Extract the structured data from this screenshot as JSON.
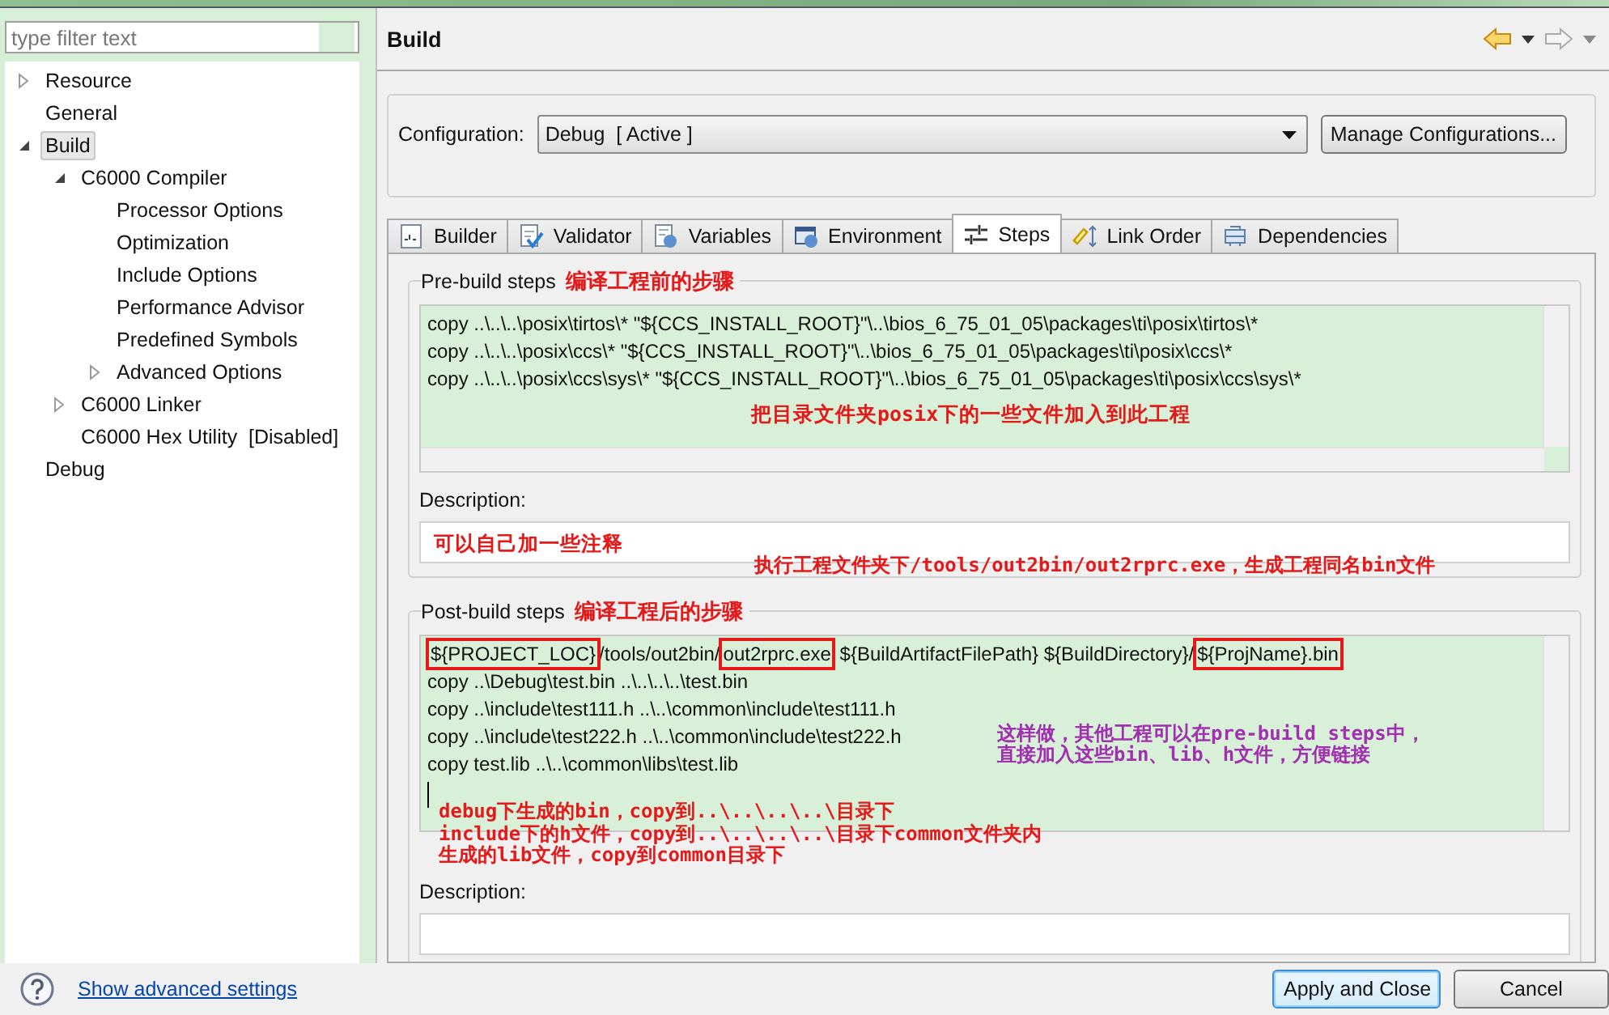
{
  "filter": {
    "placeholder": "type filter text"
  },
  "tree": [
    {
      "label": "Resource",
      "has_children": true,
      "expanded": false,
      "selected": false
    },
    {
      "label": "General",
      "has_children": false,
      "selected": false
    },
    {
      "label": "Build",
      "has_children": true,
      "expanded": true,
      "selected": true,
      "children": [
        {
          "label": "C6000 Compiler",
          "has_children": true,
          "expanded": true,
          "selected": false,
          "children": [
            {
              "label": "Processor Options",
              "has_children": false,
              "selected": false
            },
            {
              "label": "Optimization",
              "has_children": false,
              "selected": false
            },
            {
              "label": "Include Options",
              "has_children": false,
              "selected": false
            },
            {
              "label": "Performance Advisor",
              "has_children": false,
              "selected": false
            },
            {
              "label": "Predefined Symbols",
              "has_children": false,
              "selected": false
            },
            {
              "label": "Advanced Options",
              "has_children": true,
              "expanded": false,
              "selected": false
            }
          ]
        },
        {
          "label": "C6000 Linker",
          "has_children": true,
          "expanded": false,
          "selected": false
        },
        {
          "label": "C6000 Hex Utility  [Disabled]",
          "has_children": false,
          "selected": false
        }
      ]
    },
    {
      "label": "Debug",
      "has_children": false,
      "selected": false
    }
  ],
  "page_title": "Build",
  "configuration": {
    "label": "Configuration:",
    "value": "Debug  [ Active ]",
    "button": "Manage Configurations..."
  },
  "tabs": [
    {
      "label": "Builder",
      "kind": "binary",
      "selected": false
    },
    {
      "label": "Validator",
      "kind": "check",
      "selected": false
    },
    {
      "label": "Variables",
      "kind": "vars",
      "selected": false
    },
    {
      "label": "Environment",
      "kind": "env",
      "selected": false
    },
    {
      "label": "Steps",
      "kind": "steps",
      "selected": true
    },
    {
      "label": "Link Order",
      "kind": "link",
      "selected": false
    },
    {
      "label": "Dependencies",
      "kind": "deps",
      "selected": false
    }
  ],
  "pre_build": {
    "legend": "Pre-build steps",
    "annotation": "编译工程前的步骤",
    "lines": [
      "copy ..\\..\\..\\posix\\tirtos\\* \"${CCS_INSTALL_ROOT}\"\\..\\bios_6_75_01_05\\packages\\ti\\posix\\tirtos\\*",
      "copy ..\\..\\..\\posix\\ccs\\* \"${CCS_INSTALL_ROOT}\"\\..\\bios_6_75_01_05\\packages\\ti\\posix\\ccs\\*",
      "copy ..\\..\\..\\posix\\ccs\\sys\\* \"${CCS_INSTALL_ROOT}\"\\..\\bios_6_75_01_05\\packages\\ti\\posix\\ccs\\sys\\*"
    ],
    "note": "把目录文件夹posix下的一些文件加入到此工程",
    "description_label": "Description:",
    "description_value": "可以自己加一些注释"
  },
  "callout": "执行工程文件夹下/tools/out2bin/out2rprc.exe，生成工程同名bin文件",
  "post_build": {
    "legend": "Post-build steps",
    "annotation": "编译工程后的步骤",
    "lines": [
      [
        {
          "text": "${PROJECT_LOC}",
          "boxed": true
        },
        {
          "text": "/tools/out2bin/",
          "boxed": false
        },
        {
          "text": "out2rprc.exe",
          "boxed": true
        },
        {
          "text": " ${BuildArtifactFilePath} ${BuildDirectory}/",
          "boxed": false
        },
        {
          "text": "${ProjName}.bin",
          "boxed": true
        }
      ],
      [
        {
          "text": "copy ..\\Debug\\test.bin ..\\..\\..\\..\\test.bin",
          "boxed": false
        }
      ],
      [
        {
          "text": "copy ..\\include\\test111.h ..\\..\\common\\include\\test111.h",
          "boxed": false
        }
      ],
      [
        {
          "text": "copy ..\\include\\test222.h ..\\..\\common\\include\\test222.h",
          "boxed": false
        }
      ],
      [
        {
          "text": "copy test.lib ..\\..\\common\\libs\\test.lib",
          "boxed": false
        }
      ]
    ],
    "side_note": [
      "这样做，其他工程可以在pre-build steps中，",
      "直接加入这些bin、lib、h文件，方便链接"
    ],
    "notes": [
      "debug下生成的bin，copy到..\\..\\..\\..\\目录下",
      "include下的h文件，copy到..\\..\\..\\..\\目录下common文件夹内",
      "生成的lib文件，copy到common目录下"
    ],
    "description_label": "Description:"
  },
  "footer": {
    "link": "Show advanced settings",
    "buttons": [
      {
        "label": "Apply and Close",
        "default": true
      },
      {
        "label": "Cancel",
        "default": false
      }
    ]
  }
}
